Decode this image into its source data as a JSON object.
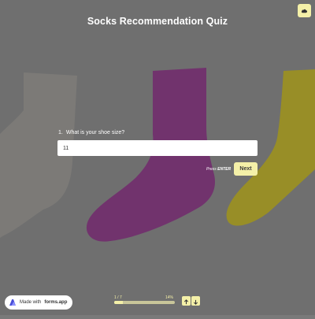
{
  "header": {
    "title": "Socks Recommendation Quiz",
    "corner_icon": "cloud-icon"
  },
  "question": {
    "number": "1.",
    "text": "What is your shoe size?",
    "answer_value": "11"
  },
  "actions": {
    "hint_prefix": "Press ",
    "hint_key": "ENTER",
    "next_label": "Next"
  },
  "footer": {
    "made_with_prefix": "Made with",
    "made_with_brand": "forms.app",
    "progress_text": "1 / 7",
    "progress_percent_text": "14%",
    "progress_fraction": 0.14,
    "nav_up_icon": "arrow-up-icon",
    "nav_down_icon": "arrow-down-icon"
  },
  "colors": {
    "accent": "#f4f0a8",
    "background_gray": "#7a7a7a",
    "sock_gray": "#8c8a86",
    "sock_purple": "#7e2f79",
    "sock_mustard": "#b0a31f"
  }
}
